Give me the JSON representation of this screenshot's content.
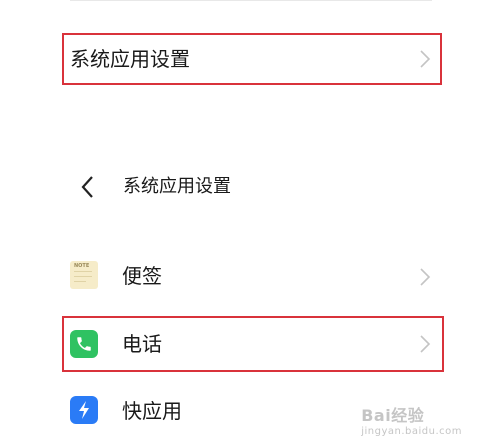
{
  "settings_entry": {
    "label": "系统应用设置"
  },
  "page_header": {
    "title": "系统应用设置"
  },
  "apps": [
    {
      "label": "便签",
      "icon": "note-icon",
      "icon_text": "NOTE"
    },
    {
      "label": "电话",
      "icon": "phone-icon"
    },
    {
      "label": "快应用",
      "icon": "quick-app-icon"
    }
  ],
  "highlight_color": "#d9323b",
  "watermark": {
    "brand": "Bai经验",
    "site": "jingyan.baidu.com"
  }
}
